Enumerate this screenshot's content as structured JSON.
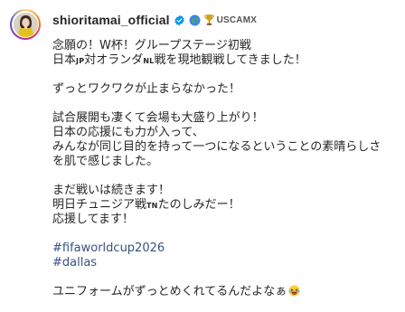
{
  "post": {
    "username": "shioritamai_official",
    "extra_tag": "USCAMX",
    "icons": [
      "verified-badge-icon",
      "globe-icon",
      "trophy-icon",
      "laughing-emoji-icon"
    ],
    "caption": {
      "line1": "念願の！W杯！グループステージ初戦",
      "line2_a": "日本",
      "line2_jp": "JP",
      "line2_b": "対オランダ",
      "line2_nl": "NL",
      "line2_c": "戦を現地観戦してきました！",
      "line3": "ずっとワクワクが止まらなかった！",
      "line4": "試合展開も凄くて会場も大盛り上がり！",
      "line5": "日本の応援にも力が入って、",
      "line6": "みんなが同じ目的を持って一つになるということの素晴らしさ",
      "line7": "を肌で感じました。",
      "line8": "まだ戦いは続きます！",
      "line9_a": "明日チュニジア戦",
      "line9_tn": "TN",
      "line9_b": "たのしみだー！",
      "line10": "応援してます！",
      "hashtag1": "#fifaworldcup2026",
      "hashtag2": "#dallas",
      "line11": "ユニフォームがずっとめくれてるんだよなぁ"
    },
    "colors": {
      "verified": "#0095f6",
      "hashtag": "#385185",
      "text": "#262626"
    }
  }
}
